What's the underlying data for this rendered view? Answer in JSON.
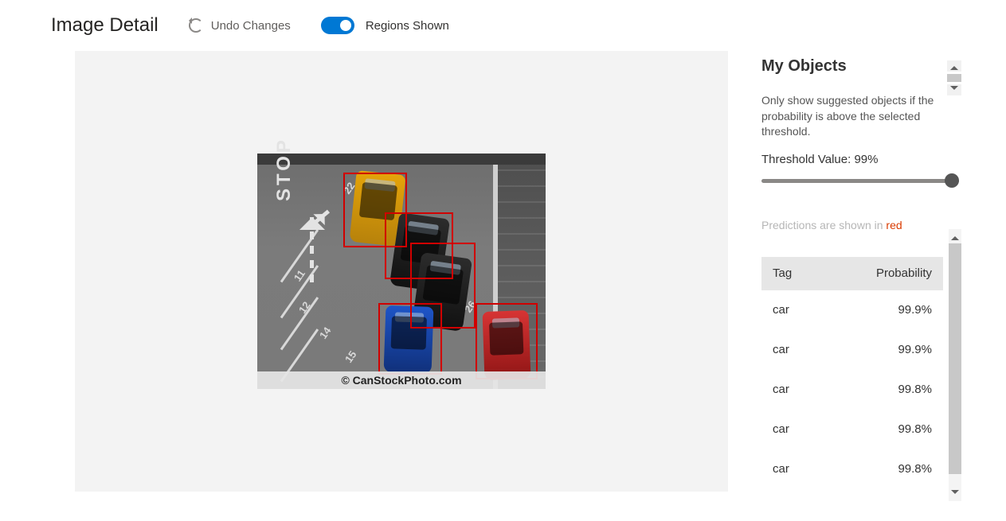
{
  "header": {
    "title": "Image Detail",
    "undo_label": "Undo Changes",
    "regions_label": "Regions Shown",
    "regions_on": true
  },
  "image": {
    "watermark": "© CanStockPhoto.com",
    "stop_text": "STOP",
    "stall_numbers": [
      "22",
      "11",
      "12",
      "14",
      "15",
      "26"
    ],
    "bounding_box_color": "#d00000",
    "cars": [
      {
        "color": "yellow"
      },
      {
        "color": "black"
      },
      {
        "color": "black"
      },
      {
        "color": "blue"
      },
      {
        "color": "red"
      }
    ]
  },
  "sidebar": {
    "title": "My Objects",
    "description": "Only show suggested objects if the probability is above the selected threshold.",
    "threshold_label_prefix": "Threshold Value: ",
    "threshold_value": "99%",
    "predictions_hint_prefix": "Predictions are shown in ",
    "predictions_hint_red": "red",
    "table": {
      "headers": {
        "tag": "Tag",
        "prob": "Probability"
      },
      "rows": [
        {
          "tag": "car",
          "prob": "99.9%"
        },
        {
          "tag": "car",
          "prob": "99.9%"
        },
        {
          "tag": "car",
          "prob": "99.8%"
        },
        {
          "tag": "car",
          "prob": "99.8%"
        },
        {
          "tag": "car",
          "prob": "99.8%"
        }
      ]
    }
  }
}
